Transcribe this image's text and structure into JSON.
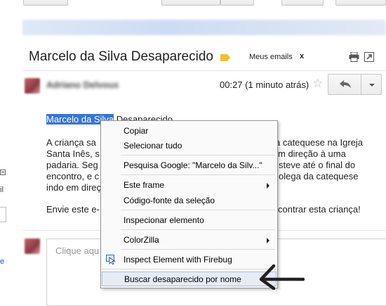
{
  "email": {
    "subject": "Marcelo da Silva Desaparecido",
    "label_name": "Meus emails",
    "label_remove": "x",
    "label_color": "#f0c22b",
    "timestamp": "00:27 (1 minuto atrás)",
    "body": {
      "line1_highlight": "Marcelo da Silva",
      "line1_rest": " Desaparecido",
      "line2_left": "A criança sa",
      "line2_right": "a catequese na Igreja",
      "line3_left": "Santa Inês, s",
      "line3_right": "m direção à uma",
      "line4_left": "padaria. Seg",
      "line4_right": "steve até o final do",
      "line5_left": "encontro, e c",
      "line5_right": "olega da catequese",
      "line6_left": "indo em direç",
      "line7_left": "Envie este e-",
      "line7_right": "contrar esta criança!"
    },
    "reply_placeholder": "Clique aqu"
  },
  "left_strip": {
    "text": "il",
    "link": "e"
  },
  "context_menu": {
    "items": [
      {
        "label": "Copiar"
      },
      {
        "label": "Selecionar tudo"
      },
      {
        "label": "Pesquisa Google: \"Marcelo da Silv...\""
      },
      {
        "label": "Este frame",
        "submenu": true
      },
      {
        "label": "Código-fonte da seleção"
      },
      {
        "label": "Inspecionar elemento"
      },
      {
        "label": "ColorZilla",
        "submenu": true
      },
      {
        "label": "Inspect Element with Firebug",
        "icon": "firebug-icon"
      },
      {
        "label": "Buscar desaparecido por nome",
        "hovered": true
      }
    ]
  },
  "colors": {
    "selection": "#3875d7",
    "menu_hover": "#e6ecf5"
  }
}
